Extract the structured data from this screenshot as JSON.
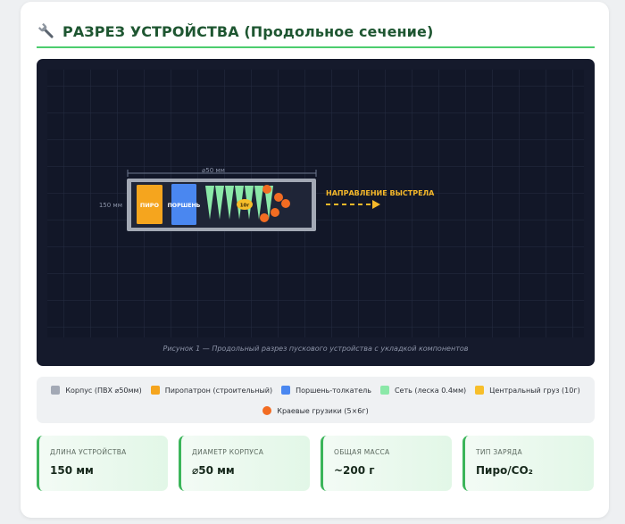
{
  "header": {
    "title": "РАЗРЕЗ УСТРОЙСТВА (Продольное сечение)"
  },
  "diagram": {
    "dimension_diameter": "⌀50 мм",
    "dimension_length": "150 мм",
    "piro_label": "ПИРО",
    "piston_label": "ПОРШЕНЬ",
    "weight_label": "10г",
    "direction_label": "НАПРАВЛЕНИЕ ВЫСТРЕЛА",
    "caption": "Рисунок 1 — Продольный разрез пускового устройства с укладкой компонентов"
  },
  "legend": {
    "items": [
      {
        "label": "Корпус (ПВХ ⌀50мм)",
        "color": "#a3a9b5",
        "shape": "square"
      },
      {
        "label": "Пиропатрон (строительный)",
        "color": "#f5a51e",
        "shape": "square"
      },
      {
        "label": "Поршень-толкатель",
        "color": "#4a87f0",
        "shape": "square"
      },
      {
        "label": "Сеть (леска 0.4мм)",
        "color": "#8be8a8",
        "shape": "square"
      },
      {
        "label": "Центральный груз (10г)",
        "color": "#f7be2a",
        "shape": "square"
      },
      {
        "label": "Краевые грузики (5×6г)",
        "color": "#f26c22",
        "shape": "circle"
      }
    ]
  },
  "stats": [
    {
      "label": "ДЛИНА УСТРОЙСТВА",
      "value": "150 мм"
    },
    {
      "label": "ДИАМЕТР КОРПУСА",
      "value": "⌀50 мм"
    },
    {
      "label": "ОБЩАЯ МАССА",
      "value": "~200 г"
    },
    {
      "label": "ТИП ЗАРЯДА",
      "value": "Пиро/CO₂"
    }
  ],
  "colors": {
    "accent": "#4ccd6e",
    "title": "#1e5631",
    "canvas_bg": "#151a2c",
    "direction": "#f5b82a"
  }
}
